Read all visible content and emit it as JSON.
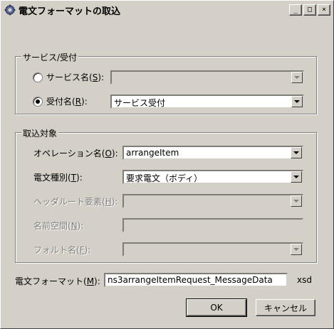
{
  "window": {
    "title": "電文フォーマットの取込",
    "controls": {
      "minimize": "_",
      "maximize": "□",
      "close": "×"
    }
  },
  "service_group": {
    "legend": "サービス/受付",
    "service_name": {
      "label": "サービス名(",
      "accel": "S",
      "suffix": "):",
      "value": "",
      "selected": false,
      "enabled": false
    },
    "reception_name": {
      "label": "受付名(",
      "accel": "R",
      "suffix": "):",
      "value": "サービス受付",
      "selected": true,
      "enabled": true
    }
  },
  "target_group": {
    "legend": "取込対象",
    "operation": {
      "label": "オペレーション名(",
      "accel": "O",
      "suffix": "):",
      "value": "arrangeItem",
      "enabled": true
    },
    "message_type": {
      "label": "電文種別(",
      "accel": "T",
      "suffix": "):",
      "value": "要求電文（ボディ）",
      "enabled": true
    },
    "header_root": {
      "label": "ヘッダルート要素(",
      "accel": "H",
      "suffix": "):",
      "value": "",
      "enabled": false
    },
    "namespace": {
      "label": "名前空間(",
      "accel": "N",
      "suffix": "):",
      "value": "",
      "enabled": false
    },
    "fault_name": {
      "label": "フォルト名(",
      "accel": "F",
      "suffix": "):",
      "value": "",
      "enabled": false
    }
  },
  "format": {
    "label": "電文フォーマット(",
    "accel": "M",
    "suffix": "):",
    "value": "ns3arrangeItemRequest_MessageData",
    "extension": "xsd"
  },
  "buttons": {
    "ok": "OK",
    "cancel": "キャンセル"
  },
  "colors": {
    "face": "#d4d0c8",
    "shadow": "#808080",
    "highlight": "#ffffff"
  }
}
